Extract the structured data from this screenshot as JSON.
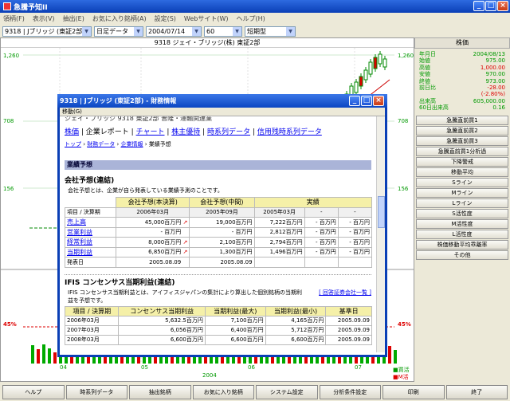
{
  "window": {
    "title": "急騰予知II"
  },
  "menu": [
    "領柄(F)",
    "表示(V)",
    "抽出(E)",
    "お気に入り銘柄(A)",
    "設定(S)",
    "Webサイト(W)",
    "ヘルプ(H)"
  ],
  "toolbar": {
    "stock": "9318 | Jブリッジ (東証2部)",
    "data_type": "日足データ",
    "date": "2004/07/14",
    "count": "60",
    "chart_type": "短期型"
  },
  "chart": {
    "header": "9318 ジェイ・ブリッジ(株) 東証2部",
    "price_labels_left": [
      "1,260",
      "708",
      "156"
    ],
    "price_labels_right": [
      "1,260",
      "708",
      "156"
    ],
    "pct_label": "45%",
    "month_labels": [
      "04",
      "05",
      "06",
      "07"
    ],
    "year_label": "2004",
    "legend": [
      "買活",
      "M活"
    ]
  },
  "side": {
    "title": "株価",
    "quote": [
      {
        "k": "年月日",
        "v": "2004/08/13",
        "red": false
      },
      {
        "k": "始値",
        "v": "975.00",
        "red": false
      },
      {
        "k": "高値",
        "v": "1,000.00",
        "red": true
      },
      {
        "k": "安値",
        "v": "970.00",
        "red": false
      },
      {
        "k": "終値",
        "v": "973.00",
        "red": false
      },
      {
        "k": "前日比",
        "v": "-28.00",
        "red": true
      },
      {
        "k": "",
        "v": "(-2.80%)",
        "red": true
      },
      {
        "k": "出来高",
        "v": "605,000.00",
        "red": false
      },
      {
        "k": "60日出来高",
        "v": "0.16",
        "red": false
      }
    ],
    "buttons": [
      "急騰直前買1",
      "急騰直前買2",
      "急騰直前買3",
      "急騰直前買1分析過",
      "下降警戒",
      "移動平均",
      "Sライン",
      "Mライン",
      "Lライン",
      "S活性度",
      "M活性度",
      "L活性度",
      "株価移動平均乖離率",
      "その他"
    ]
  },
  "bottom_buttons": [
    "ヘルプ",
    "時系列データ",
    "抽出銘柄",
    "お気に入り銘柄",
    "システム設定",
    "分析条件設定",
    "印刷",
    "終了"
  ],
  "dialog": {
    "title": "9318 | Jブリッジ (東証2部) - 財務情報",
    "menu": "移動(G)",
    "cut_line": "ジェイ・ブリッジ  9318 東証2部 普隆・運輸関連業",
    "links": [
      "株価",
      "企業レポート",
      "チャート",
      "株主優待",
      "時系列データ",
      "信用残時系列データ"
    ],
    "breadcrumb": [
      "トップ",
      "財務データ",
      "企業情報",
      "業績予想"
    ],
    "section": "業績予想",
    "company_forecast": {
      "title": "会社予想(連結)",
      "note": "会社予想とは、企業が自ら発表している業績予測のことです。",
      "group_headers": [
        "会社予想(本決算)",
        "会社予想(中間)",
        "実績"
      ],
      "period_label": "項目 / 決算期",
      "periods": [
        "2006年03月",
        "2005年09月",
        "2005年03月",
        "-",
        "-"
      ],
      "rows": [
        {
          "label": "売上高",
          "link": true,
          "v": [
            "45,000百万円",
            "19,000百万円",
            "7,222百万円",
            "- 百万円",
            "- 百万円"
          ],
          "up": true
        },
        {
          "label": "営業利益",
          "link": true,
          "v": [
            "- 百万円",
            "- 百万円",
            "2,812百万円",
            "- 百万円",
            "- 百万円"
          ],
          "up": false
        },
        {
          "label": "経常利益",
          "link": true,
          "v": [
            "8,000百万円",
            "2,100百万円",
            "2,794百万円",
            "- 百万円",
            "- 百万円"
          ],
          "up": true
        },
        {
          "label": "当期利益",
          "link": true,
          "v": [
            "6,850百万円",
            "1,300百万円",
            "1,496百万円",
            "- 百万円",
            "- 百万円"
          ],
          "up": true
        },
        {
          "label": "発表日",
          "link": false,
          "v": [
            "2005.08.09",
            "2005.08.09",
            "",
            "",
            ""
          ],
          "up": false
        }
      ]
    },
    "ifis": {
      "title": "IFIS コンセンサス当期利益(連結)",
      "note": "IFIS コンセンサス当期利益とは、アイフィスジャパンの集計により算出した個別銘柄の当期利益を予想です。",
      "link": "[ 回答証券会社一覧 ]",
      "headers": [
        "項目 / 決算期",
        "コンセンサス当期利益",
        "当期利益(最大)",
        "当期利益(最小)",
        "基準日"
      ],
      "rows": [
        [
          "2006年03月",
          "5,632.5百万円",
          "7,100百万円",
          "4,165百万円",
          "2005.09.09"
        ],
        [
          "2007年03月",
          "6,056百万円",
          "6,400百万円",
          "5,712百万円",
          "2005.09.09"
        ],
        [
          "2008年03月",
          "6,600百万円",
          "6,600百万円",
          "6,600百万円",
          "2005.09.09"
        ]
      ]
    }
  }
}
